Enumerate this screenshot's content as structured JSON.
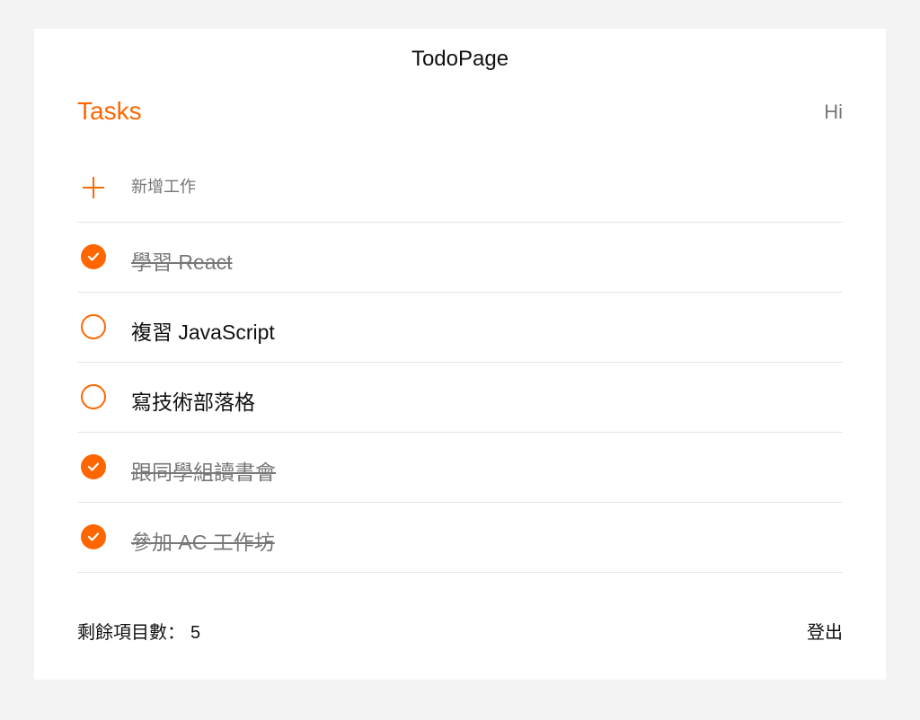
{
  "app": {
    "title": "TodoPage"
  },
  "header": {
    "tasks_title": "Tasks",
    "greeting": "Hi"
  },
  "add_task": {
    "placeholder": "新增工作"
  },
  "tasks": [
    {
      "label": "學習 React",
      "done": true
    },
    {
      "label": "複習 JavaScript",
      "done": false
    },
    {
      "label": "寫技術部落格",
      "done": false
    },
    {
      "label": "跟同學組讀書會",
      "done": true
    },
    {
      "label": "參加 AC 工作坊",
      "done": true
    }
  ],
  "footer": {
    "remaining_label": "剩餘項目數：",
    "remaining_count": "5",
    "logout_label": "登出"
  },
  "colors": {
    "accent": "#ff6600",
    "background": "#f3f3f3",
    "card": "#ffffff",
    "done_text": "#777777"
  },
  "icons": {
    "add": "plus-icon",
    "done": "check-circle-filled-icon",
    "todo": "circle-outline-icon"
  }
}
